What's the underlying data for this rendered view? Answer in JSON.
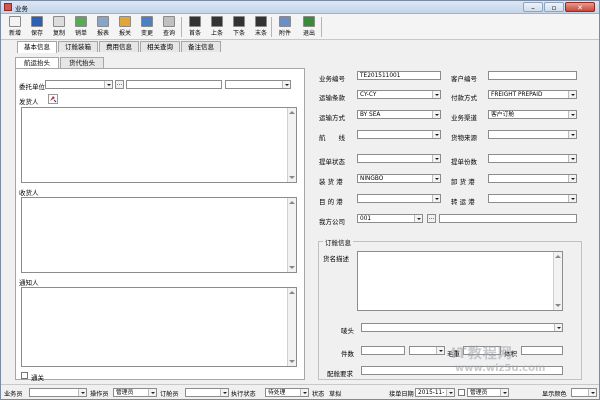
{
  "window": {
    "title": "业务",
    "minimize": "–",
    "restore": "▫",
    "close": "✕"
  },
  "toolbar": [
    {
      "label": "新增",
      "icon": "new-document-icon",
      "color": "#f3f3f3"
    },
    {
      "label": "保存",
      "icon": "save-disk-icon",
      "color": "#2d5fb5"
    },
    {
      "label": "复制",
      "icon": "copy-icon",
      "color": "#dcdcdc"
    },
    {
      "label": "销单",
      "icon": "cancel-order-icon",
      "color": "#5ba85b"
    },
    {
      "label": "报表",
      "icon": "report-icon",
      "color": "#8aa4c8"
    },
    {
      "label": "报关",
      "icon": "customs-icon",
      "color": "#e0a63a"
    },
    {
      "label": "变更",
      "icon": "change-icon",
      "color": "#4e7fc2"
    },
    {
      "label": "查询",
      "icon": "query-icon",
      "color": "#c0c0c0"
    },
    {
      "label": "首条",
      "icon": "first-record-icon",
      "color": "#333"
    },
    {
      "label": "上条",
      "icon": "previous-record-icon",
      "color": "#333"
    },
    {
      "label": "下条",
      "icon": "next-record-icon",
      "color": "#333"
    },
    {
      "label": "末条",
      "icon": "last-record-icon",
      "color": "#333"
    },
    {
      "label": "附件",
      "icon": "attachment-icon",
      "color": "#6b8ec7"
    },
    {
      "label": "退出",
      "icon": "exit-icon",
      "color": "#3a8a3a"
    }
  ],
  "tabs": [
    "基本信息",
    "订舱装箱",
    "费用信息",
    "相关查询",
    "备注信息"
  ],
  "subtabs": [
    "航运抬头",
    "货代抬头"
  ],
  "left": {
    "consignor_label": "委托单位",
    "consignor_value": "",
    "ellipsis": "...",
    "shipper_label": "发货人",
    "consignee_label": "收货人",
    "notify_label": "通知人",
    "customs_check_label": "通关"
  },
  "right": {
    "biz_no_label": "业务编号",
    "biz_no_value": "TE201511001",
    "cust_no_label": "客户编号",
    "cust_no_value": "",
    "terms_label": "运输条款",
    "terms_value": "CY-CY",
    "payment_label": "付款方式",
    "payment_value": "FREIGHT PREPAID",
    "mode_label": "运输方式",
    "mode_value": "BY SEA",
    "channel_label": "业务渠道",
    "channel_value": "客户订舱",
    "route_label": "航　　线",
    "route_value": "",
    "source_label": "货物来源",
    "source_value": "",
    "bl_status_label": "提单状态",
    "bl_status_value": "",
    "bl_copies_label": "提单份数",
    "bl_copies_value": "",
    "pol_label": "装 货 港",
    "pol_value": "NINGBO",
    "pod_label": "卸 货 港",
    "pod_value": "",
    "dest_label": "目 的 港",
    "dest_value": "",
    "transit_label": "转 运 港",
    "transit_value": "",
    "company_label": "我方公司",
    "company_value": "001",
    "ellipsis": "...",
    "booking_group": "订舱信息",
    "goods_label": "货名描述",
    "marks_label": "唛头",
    "pieces_label": "件数",
    "weight_label": "毛重",
    "volume_label": "体积",
    "booking_req_label": "配舱要求"
  },
  "status": {
    "sales_label": "业务员",
    "sales_value": "",
    "operator_label": "操作员",
    "operator_value": "管理员",
    "booker_label": "订舱员",
    "booker_value": "",
    "exec_status_label": "执行状态",
    "exec_status_value": "待处理",
    "state_label": "状态",
    "state_value": "草拟",
    "accept_date_label": "接单日期",
    "accept_date_value": "2015-11-",
    "creator_value": "管理员",
    "mark_color_label": "显示颜色"
  },
  "watermark": {
    "cn": "IT教程网",
    "en": "www.wiz5u.com"
  }
}
